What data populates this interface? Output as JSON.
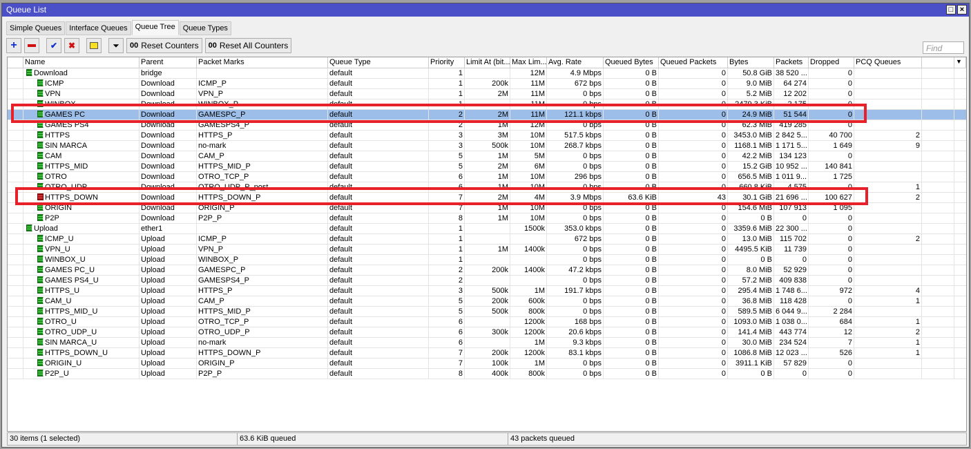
{
  "window": {
    "title": "Queue List"
  },
  "tabs": [
    "Simple Queues",
    "Interface Queues",
    "Queue Tree",
    "Queue Types"
  ],
  "active_tab": "Queue Tree",
  "toolbar": {
    "reset_counters": "Reset Counters",
    "reset_all_counters": "Reset All Counters",
    "counter_glyph": "00"
  },
  "find_placeholder": "Find",
  "columns": [
    "Name",
    "Parent",
    "Packet Marks",
    "Queue Type",
    "Priority",
    "Limit At (bit...",
    "Max Lim...",
    "Avg. Rate",
    "Queued Bytes",
    "Queued Packets",
    "Bytes",
    "Packets",
    "Dropped",
    "PCQ Queues"
  ],
  "rows": [
    {
      "name": "Download",
      "parent": "bridge",
      "marks": "",
      "type": "default",
      "prio": "1",
      "limit": "",
      "max": "12M",
      "rate": "4.9 Mbps",
      "qbytes": "0 B",
      "qpkts": "0",
      "bytes": "50.8 GiB",
      "pkts": "38 520 ...",
      "dropped": "0",
      "pcq": "",
      "level": 0
    },
    {
      "name": "ICMP",
      "parent": "Download",
      "marks": "ICMP_P",
      "type": "default",
      "prio": "1",
      "limit": "200k",
      "max": "11M",
      "rate": "672 bps",
      "qbytes": "0 B",
      "qpkts": "0",
      "bytes": "9.0 MiB",
      "pkts": "64 274",
      "dropped": "0",
      "pcq": "",
      "level": 1
    },
    {
      "name": "VPN",
      "parent": "Download",
      "marks": "VPN_P",
      "type": "default",
      "prio": "1",
      "limit": "2M",
      "max": "11M",
      "rate": "0 bps",
      "qbytes": "0 B",
      "qpkts": "0",
      "bytes": "5.2 MiB",
      "pkts": "12 202",
      "dropped": "0",
      "pcq": "",
      "level": 1
    },
    {
      "name": "WINBOX",
      "parent": "Download",
      "marks": "WINBOX_P",
      "type": "default",
      "prio": "1",
      "limit": "",
      "max": "11M",
      "rate": "0 bps",
      "qbytes": "0 B",
      "qpkts": "0",
      "bytes": "2479.3 KiB",
      "pkts": "2 175",
      "dropped": "0",
      "pcq": "",
      "level": 1
    },
    {
      "name": "GAMES PC",
      "parent": "Download",
      "marks": "GAMESPC_P",
      "type": "default",
      "prio": "2",
      "limit": "2M",
      "max": "11M",
      "rate": "121.1 kbps",
      "qbytes": "0 B",
      "qpkts": "0",
      "bytes": "24.9 MiB",
      "pkts": "51 544",
      "dropped": "0",
      "pcq": "",
      "level": 1,
      "selected": true
    },
    {
      "name": "GAMES PS4",
      "parent": "Download",
      "marks": "GAMESPS4_P",
      "type": "default",
      "prio": "2",
      "limit": "1M",
      "max": "12M",
      "rate": "0 bps",
      "qbytes": "0 B",
      "qpkts": "0",
      "bytes": "62.3 MiB",
      "pkts": "419 285",
      "dropped": "0",
      "pcq": "",
      "level": 1
    },
    {
      "name": "HTTPS",
      "parent": "Download",
      "marks": "HTTPS_P",
      "type": "default",
      "prio": "3",
      "limit": "3M",
      "max": "10M",
      "rate": "517.5 kbps",
      "qbytes": "0 B",
      "qpkts": "0",
      "bytes": "3453.0 MiB",
      "pkts": "2 842 5...",
      "dropped": "40 700",
      "pcq": "2",
      "level": 1
    },
    {
      "name": "SIN MARCA",
      "parent": "Download",
      "marks": "no-mark",
      "type": "default",
      "prio": "3",
      "limit": "500k",
      "max": "10M",
      "rate": "268.7 kbps",
      "qbytes": "0 B",
      "qpkts": "0",
      "bytes": "1168.1 MiB",
      "pkts": "1 171 5...",
      "dropped": "1 649",
      "pcq": "9",
      "level": 1
    },
    {
      "name": "CAM",
      "parent": "Download",
      "marks": "CAM_P",
      "type": "default",
      "prio": "5",
      "limit": "1M",
      "max": "5M",
      "rate": "0 bps",
      "qbytes": "0 B",
      "qpkts": "0",
      "bytes": "42.2 MiB",
      "pkts": "134 123",
      "dropped": "0",
      "pcq": "",
      "level": 1
    },
    {
      "name": "HTTPS_MID",
      "parent": "Download",
      "marks": "HTTPS_MID_P",
      "type": "default",
      "prio": "5",
      "limit": "2M",
      "max": "6M",
      "rate": "0 bps",
      "qbytes": "0 B",
      "qpkts": "0",
      "bytes": "15.2 GiB",
      "pkts": "10 952 ...",
      "dropped": "140 841",
      "pcq": "",
      "level": 1
    },
    {
      "name": "OTRO",
      "parent": "Download",
      "marks": "OTRO_TCP_P",
      "type": "default",
      "prio": "6",
      "limit": "1M",
      "max": "10M",
      "rate": "296 bps",
      "qbytes": "0 B",
      "qpkts": "0",
      "bytes": "656.5 MiB",
      "pkts": "1 011 9...",
      "dropped": "1 725",
      "pcq": "",
      "level": 1
    },
    {
      "name": "OTRO_UDP",
      "parent": "Download",
      "marks": "OTRO_UDP_P_post",
      "type": "default",
      "prio": "6",
      "limit": "1M",
      "max": "10M",
      "rate": "0 bps",
      "qbytes": "0 B",
      "qpkts": "0",
      "bytes": "660.8 KiB",
      "pkts": "4 575",
      "dropped": "0",
      "pcq": "1",
      "level": 1
    },
    {
      "name": "HTTPS_DOWN",
      "parent": "Download",
      "marks": "HTTPS_DOWN_P",
      "type": "default",
      "prio": "7",
      "limit": "2M",
      "max": "4M",
      "rate": "3.9 Mbps",
      "qbytes": "63.6 KiB",
      "qpkts": "43",
      "bytes": "30.1 GiB",
      "pkts": "21 696 ...",
      "dropped": "100 627",
      "pcq": "2",
      "level": 1,
      "status": "red"
    },
    {
      "name": "ORIGIN",
      "parent": "Download",
      "marks": "ORIGIN_P",
      "type": "default",
      "prio": "7",
      "limit": "1M",
      "max": "10M",
      "rate": "0 bps",
      "qbytes": "0 B",
      "qpkts": "0",
      "bytes": "154.6 MiB",
      "pkts": "107 913",
      "dropped": "1 095",
      "pcq": "",
      "level": 1
    },
    {
      "name": "P2P",
      "parent": "Download",
      "marks": "P2P_P",
      "type": "default",
      "prio": "8",
      "limit": "1M",
      "max": "10M",
      "rate": "0 bps",
      "qbytes": "0 B",
      "qpkts": "0",
      "bytes": "0 B",
      "pkts": "0",
      "dropped": "0",
      "pcq": "",
      "level": 1
    },
    {
      "name": "Upload",
      "parent": "ether1",
      "marks": "",
      "type": "default",
      "prio": "1",
      "limit": "",
      "max": "1500k",
      "rate": "353.0 kbps",
      "qbytes": "0 B",
      "qpkts": "0",
      "bytes": "3359.6 MiB",
      "pkts": "22 300 ...",
      "dropped": "0",
      "pcq": "",
      "level": 0
    },
    {
      "name": "ICMP_U",
      "parent": "Upload",
      "marks": "ICMP_P",
      "type": "default",
      "prio": "1",
      "limit": "",
      "max": "",
      "rate": "672 bps",
      "qbytes": "0 B",
      "qpkts": "0",
      "bytes": "13.0 MiB",
      "pkts": "115 702",
      "dropped": "0",
      "pcq": "2",
      "level": 1
    },
    {
      "name": "VPN_U",
      "parent": "Upload",
      "marks": "VPN_P",
      "type": "default",
      "prio": "1",
      "limit": "1M",
      "max": "1400k",
      "rate": "0 bps",
      "qbytes": "0 B",
      "qpkts": "0",
      "bytes": "4495.5 KiB",
      "pkts": "11 739",
      "dropped": "0",
      "pcq": "",
      "level": 1
    },
    {
      "name": "WINBOX_U",
      "parent": "Upload",
      "marks": "WINBOX_P",
      "type": "default",
      "prio": "1",
      "limit": "",
      "max": "",
      "rate": "0 bps",
      "qbytes": "0 B",
      "qpkts": "0",
      "bytes": "0 B",
      "pkts": "0",
      "dropped": "0",
      "pcq": "",
      "level": 1
    },
    {
      "name": "GAMES PC_U",
      "parent": "Upload",
      "marks": "GAMESPC_P",
      "type": "default",
      "prio": "2",
      "limit": "200k",
      "max": "1400k",
      "rate": "47.2 kbps",
      "qbytes": "0 B",
      "qpkts": "0",
      "bytes": "8.0 MiB",
      "pkts": "52 929",
      "dropped": "0",
      "pcq": "",
      "level": 1
    },
    {
      "name": "GAMES PS4_U",
      "parent": "Upload",
      "marks": "GAMESPS4_P",
      "type": "default",
      "prio": "2",
      "limit": "",
      "max": "",
      "rate": "0 bps",
      "qbytes": "0 B",
      "qpkts": "0",
      "bytes": "57.2 MiB",
      "pkts": "409 838",
      "dropped": "0",
      "pcq": "",
      "level": 1
    },
    {
      "name": "HTTPS_U",
      "parent": "Upload",
      "marks": "HTTPS_P",
      "type": "default",
      "prio": "3",
      "limit": "500k",
      "max": "1M",
      "rate": "191.7 kbps",
      "qbytes": "0 B",
      "qpkts": "0",
      "bytes": "295.4 MiB",
      "pkts": "1 748 6...",
      "dropped": "972",
      "pcq": "4",
      "level": 1
    },
    {
      "name": "CAM_U",
      "parent": "Upload",
      "marks": "CAM_P",
      "type": "default",
      "prio": "5",
      "limit": "200k",
      "max": "600k",
      "rate": "0 bps",
      "qbytes": "0 B",
      "qpkts": "0",
      "bytes": "36.8 MiB",
      "pkts": "118 428",
      "dropped": "0",
      "pcq": "1",
      "level": 1
    },
    {
      "name": "HTTPS_MID_U",
      "parent": "Upload",
      "marks": "HTTPS_MID_P",
      "type": "default",
      "prio": "5",
      "limit": "500k",
      "max": "800k",
      "rate": "0 bps",
      "qbytes": "0 B",
      "qpkts": "0",
      "bytes": "589.5 MiB",
      "pkts": "6 044 9...",
      "dropped": "2 284",
      "pcq": "",
      "level": 1
    },
    {
      "name": "OTRO_U",
      "parent": "Upload",
      "marks": "OTRO_TCP_P",
      "type": "default",
      "prio": "6",
      "limit": "",
      "max": "1200k",
      "rate": "168 bps",
      "qbytes": "0 B",
      "qpkts": "0",
      "bytes": "1093.0 MiB",
      "pkts": "1 038 0...",
      "dropped": "684",
      "pcq": "1",
      "level": 1
    },
    {
      "name": "OTRO_UDP_U",
      "parent": "Upload",
      "marks": "OTRO_UDP_P",
      "type": "default",
      "prio": "6",
      "limit": "300k",
      "max": "1200k",
      "rate": "20.6 kbps",
      "qbytes": "0 B",
      "qpkts": "0",
      "bytes": "141.4 MiB",
      "pkts": "443 774",
      "dropped": "12",
      "pcq": "2",
      "level": 1
    },
    {
      "name": "SIN MARCA_U",
      "parent": "Upload",
      "marks": "no-mark",
      "type": "default",
      "prio": "6",
      "limit": "",
      "max": "1M",
      "rate": "9.3 kbps",
      "qbytes": "0 B",
      "qpkts": "0",
      "bytes": "30.0 MiB",
      "pkts": "234 524",
      "dropped": "7",
      "pcq": "1",
      "level": 1
    },
    {
      "name": "HTTPS_DOWN_U",
      "parent": "Upload",
      "marks": "HTTPS_DOWN_P",
      "type": "default",
      "prio": "7",
      "limit": "200k",
      "max": "1200k",
      "rate": "83.1 kbps",
      "qbytes": "0 B",
      "qpkts": "0",
      "bytes": "1086.8 MiB",
      "pkts": "12 023 ...",
      "dropped": "526",
      "pcq": "1",
      "level": 1
    },
    {
      "name": "ORIGIN_U",
      "parent": "Upload",
      "marks": "ORIGIN_P",
      "type": "default",
      "prio": "7",
      "limit": "100k",
      "max": "1M",
      "rate": "0 bps",
      "qbytes": "0 B",
      "qpkts": "0",
      "bytes": "3911.1 KiB",
      "pkts": "57 829",
      "dropped": "0",
      "pcq": "",
      "level": 1
    },
    {
      "name": "P2P_U",
      "parent": "Upload",
      "marks": "P2P_P",
      "type": "default",
      "prio": "8",
      "limit": "400k",
      "max": "800k",
      "rate": "0 bps",
      "qbytes": "0 B",
      "qpkts": "0",
      "bytes": "0 B",
      "pkts": "0",
      "dropped": "0",
      "pcq": "",
      "level": 1
    }
  ],
  "status": {
    "items": "30 items (1 selected)",
    "queued_bytes": "63.6 KiB queued",
    "queued_packets": "43 packets queued"
  },
  "colors": {
    "titlebar": "#4b50c9",
    "selected_row": "#9cbee9",
    "highlight_box": "#e8202a"
  }
}
